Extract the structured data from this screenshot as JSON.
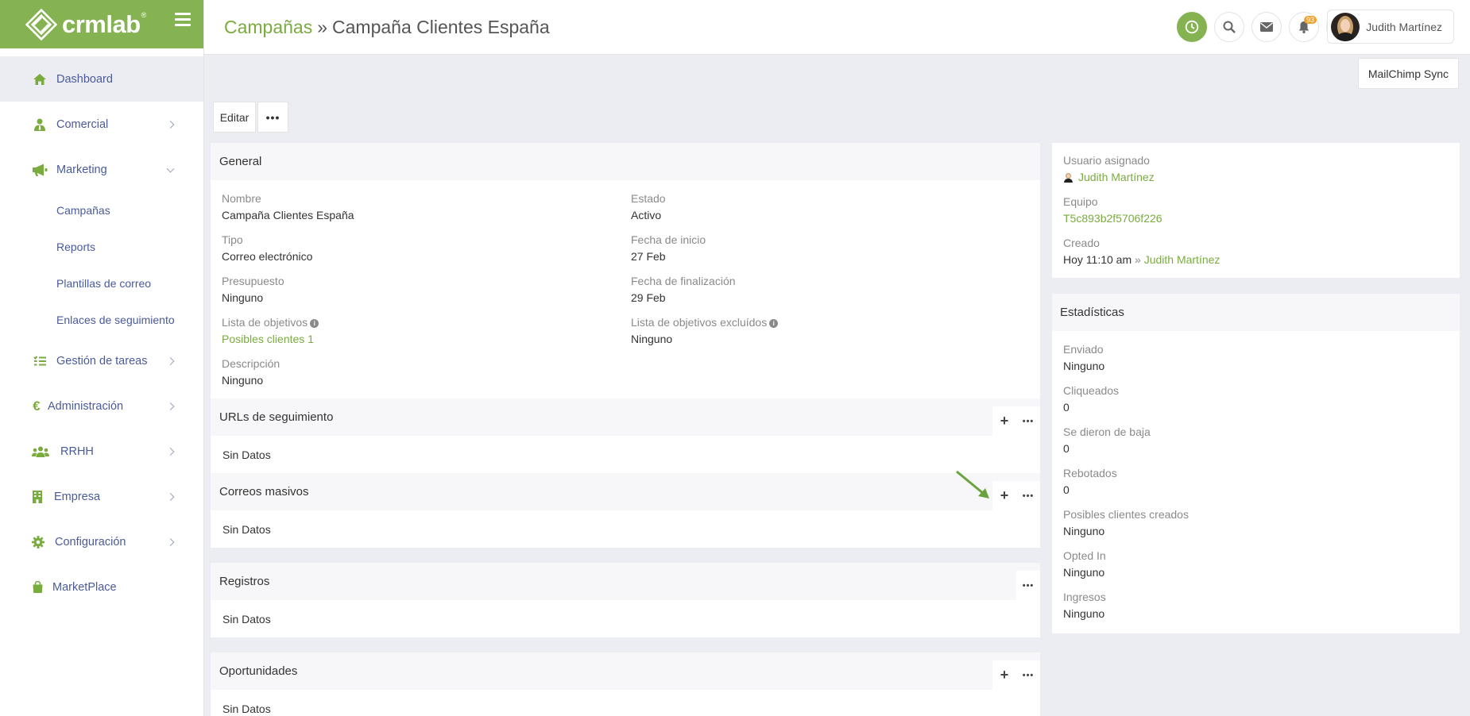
{
  "brand": {
    "name": "crmlab",
    "reg": "®",
    "accent": "#86b352",
    "link_color": "#7aab3f",
    "nav_color": "#4a5a9a"
  },
  "sidebar": {
    "items": [
      {
        "label": "Dashboard",
        "icon": "home-icon"
      },
      {
        "label": "Comercial",
        "icon": "user-tie-icon"
      },
      {
        "label": "Marketing",
        "icon": "megaphone-icon"
      },
      {
        "label": "Gestión de tareas",
        "icon": "tasks-icon"
      },
      {
        "label": "Administración",
        "icon": "euro-icon"
      },
      {
        "label": "RRHH",
        "icon": "users-icon"
      },
      {
        "label": "Empresa",
        "icon": "building-icon"
      },
      {
        "label": "Configuración",
        "icon": "gear-icon"
      },
      {
        "label": "MarketPlace",
        "icon": "bag-icon"
      }
    ],
    "marketing_sub": [
      "Campañas",
      "Reports",
      "Plantillas de correo",
      "Enlaces de seguimiento"
    ]
  },
  "header": {
    "crumb": "Campañas",
    "separator": "»",
    "title": "Campaña Clientes España",
    "notifications_count": "93",
    "user_name": "Judith Martínez"
  },
  "actions": {
    "mailchimp": "MailChimp Sync",
    "edit": "Editar",
    "more": "•••"
  },
  "general": {
    "title": "General",
    "nombre_label": "Nombre",
    "nombre_value": "Campaña Clientes España",
    "estado_label": "Estado",
    "estado_value": "Activo",
    "tipo_label": "Tipo",
    "tipo_value": "Correo electrónico",
    "inicio_label": "Fecha de inicio",
    "inicio_value": "27 Feb",
    "presupuesto_label": "Presupuesto",
    "presupuesto_value": "Ninguno",
    "fin_label": "Fecha de finalización",
    "fin_value": "29 Feb",
    "objetivos_label": "Lista de objetivos",
    "objetivos_value": "Posibles clientes 1",
    "excluidos_label": "Lista de objetivos excluídos",
    "excluidos_value": "Ninguno",
    "descripcion_label": "Descripción",
    "descripcion_value": "Ninguno"
  },
  "panels": {
    "urls": "URLs de seguimiento",
    "correos": "Correos masivos",
    "registros": "Registros",
    "oportunidades": "Oportunidades",
    "empty": "Sin Datos"
  },
  "side_info": {
    "usuario_label": "Usuario asignado",
    "usuario_value": "Judith Martínez",
    "equipo_label": "Equipo",
    "equipo_value": "T5c893b2f5706f226",
    "creado_label": "Creado",
    "creado_time": "Hoy 11:10 am",
    "creado_sep": "»",
    "creado_user": "Judith Martínez"
  },
  "stats": {
    "title": "Estadísticas",
    "items": [
      {
        "label": "Enviado",
        "value": "Ninguno"
      },
      {
        "label": "Cliqueados",
        "value": "0"
      },
      {
        "label": "Se dieron de baja",
        "value": "0"
      },
      {
        "label": "Rebotados",
        "value": "0"
      },
      {
        "label": "Posibles clientes creados",
        "value": "Ninguno"
      },
      {
        "label": "Opted In",
        "value": "Ninguno"
      },
      {
        "label": "Ingresos",
        "value": "Ninguno"
      }
    ]
  }
}
